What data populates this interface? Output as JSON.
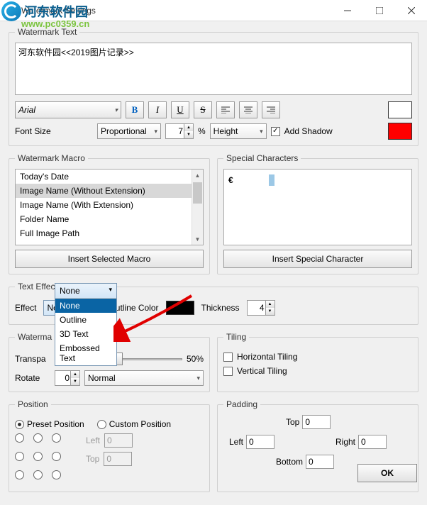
{
  "window": {
    "title": "Watermark Settings"
  },
  "overlay": {
    "brand": "河东软件园",
    "url": "www.pc0359.cn"
  },
  "textGroup": {
    "legend": "Watermark Text",
    "value": "河东软件园<<2019图片记录>>"
  },
  "fontRow": {
    "fontName": "Arial",
    "sizeLabel": "Font Size",
    "sizeMode": "Proportional",
    "sizeValue": "7",
    "percent": "%",
    "heightMode": "Height",
    "addShadowLabel": "Add Shadow",
    "addShadowChecked": true
  },
  "macro": {
    "legend": "Watermark Macro",
    "items": [
      "Today's Date",
      "Image Name (Without Extension)",
      "Image Name (With Extension)",
      "Folder Name",
      "Full Image Path"
    ],
    "selectedIndex": 1,
    "button": "Insert Selected Macro"
  },
  "special": {
    "legend": "Special Characters",
    "sample": "€",
    "button": "Insert Special Character"
  },
  "effects": {
    "legend": "Text Effects",
    "effectLabel": "Effect",
    "selected": "None",
    "options": [
      "None",
      "Outline",
      "3D Text",
      "Embossed Text"
    ],
    "outlineColorLabel": "Outline Color",
    "thicknessLabel": "Thickness",
    "thicknessVal": "4"
  },
  "wmSettings": {
    "legend": "Waterma",
    "transparencyLabel": "Transpa",
    "transparencyVal": "50%",
    "rotateLabel": "Rotate",
    "rotateVal": "0",
    "normal": "Normal"
  },
  "tiling": {
    "legend": "Tiling",
    "hLabel": "Horizontal Tiling",
    "vLabel": "Vertical Tiling"
  },
  "position": {
    "legend": "Position",
    "presetLabel": "Preset Position",
    "customLabel": "Custom Position",
    "leftLabel": "Left",
    "topLabel": "Top",
    "leftVal": "0",
    "topVal": "0"
  },
  "padding": {
    "legend": "Padding",
    "topLabel": "Top",
    "topVal": "0",
    "leftLabel": "Left",
    "leftVal": "0",
    "rightLabel": "Right",
    "rightVal": "0",
    "bottomLabel": "Bottom",
    "bottomVal": "0"
  },
  "ok": "OK"
}
